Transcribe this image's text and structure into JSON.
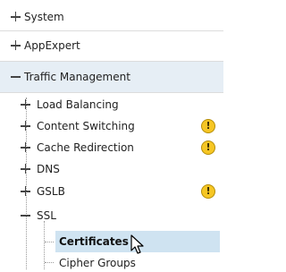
{
  "nav": {
    "system": "System",
    "appexpert": "AppExpert",
    "traffic_management": "Traffic Management",
    "load_balancing": "Load Balancing",
    "content_switching": "Content Switching",
    "cache_redirection": "Cache Redirection",
    "dns": "DNS",
    "gslb": "GSLB",
    "ssl": "SSL",
    "certificates": "Certificates",
    "cipher_groups": "Cipher Groups",
    "warning_glyph": "!"
  },
  "colors": {
    "selected_bg": "#cfe3f1",
    "expanded_header_bg": "#e6eef5",
    "warning": "#f6c624"
  }
}
